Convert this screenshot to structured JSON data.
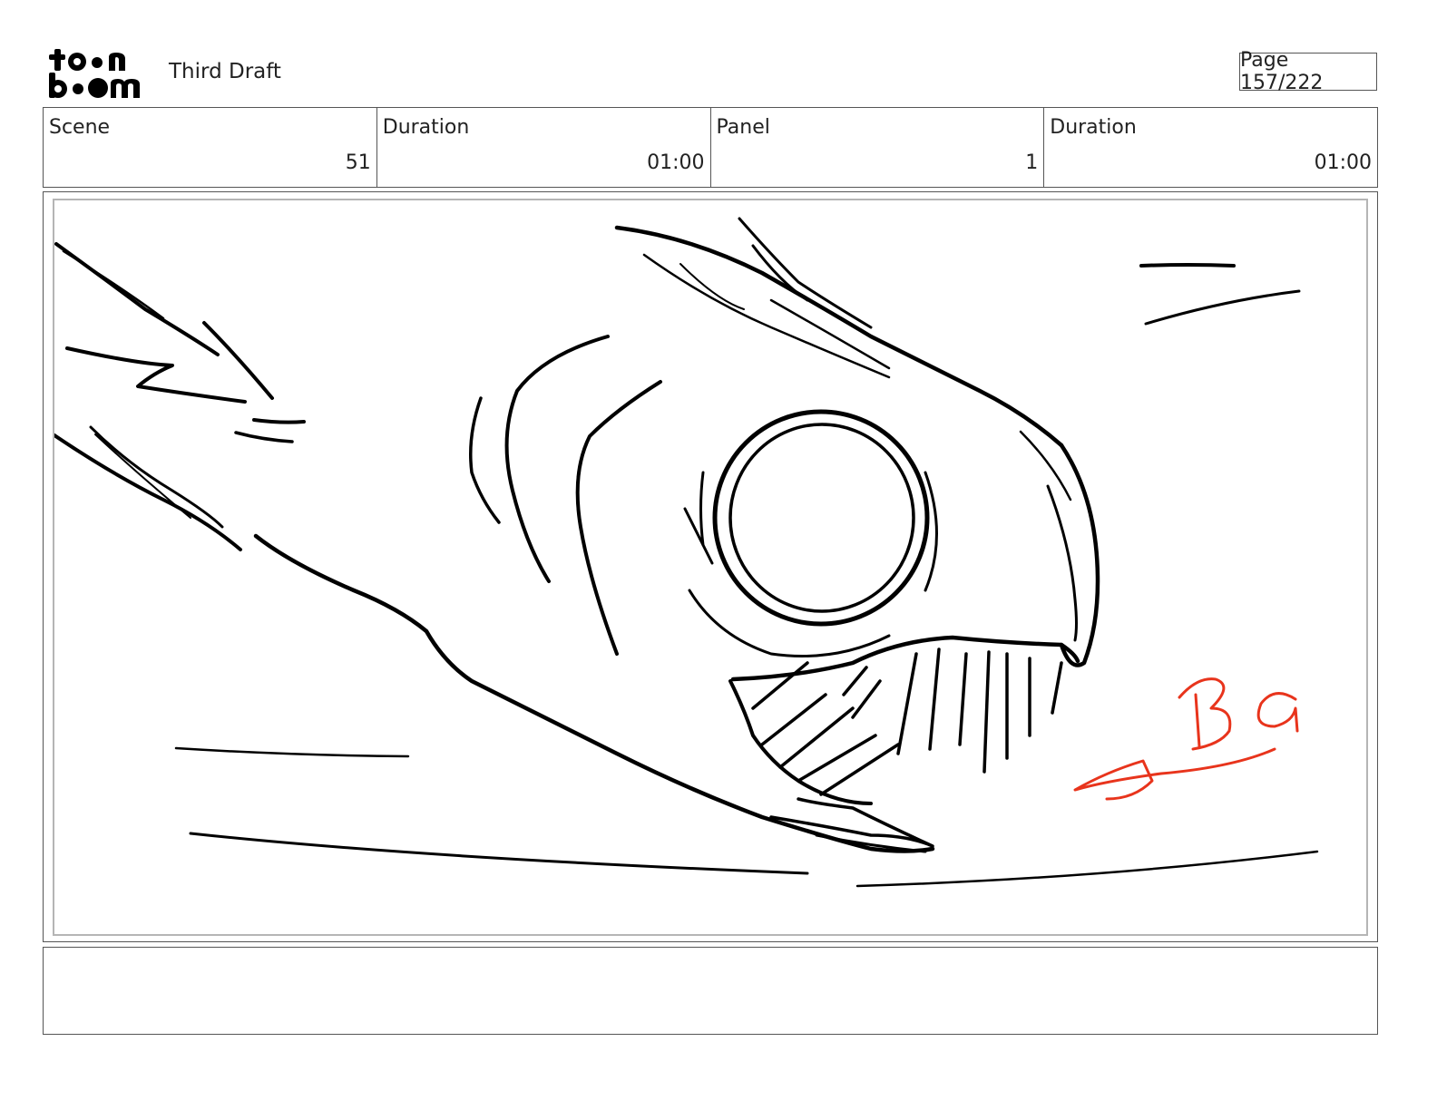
{
  "header": {
    "logo": {
      "line1": "toon",
      "line2": "boom"
    },
    "document_title": "Third Draft",
    "page_label": "Page 157/222"
  },
  "info": {
    "scene_label": "Scene",
    "scene_value": "51",
    "scene_duration_label": "Duration",
    "scene_duration_value": "01:00",
    "panel_label": "Panel",
    "panel_value": "1",
    "panel_duration_label": "Duration",
    "panel_duration_value": "01:00"
  },
  "panel": {
    "annotation": "BG",
    "annotation_color": "#e8341c",
    "ink_color": "#000000"
  },
  "notes": {
    "text": ""
  }
}
